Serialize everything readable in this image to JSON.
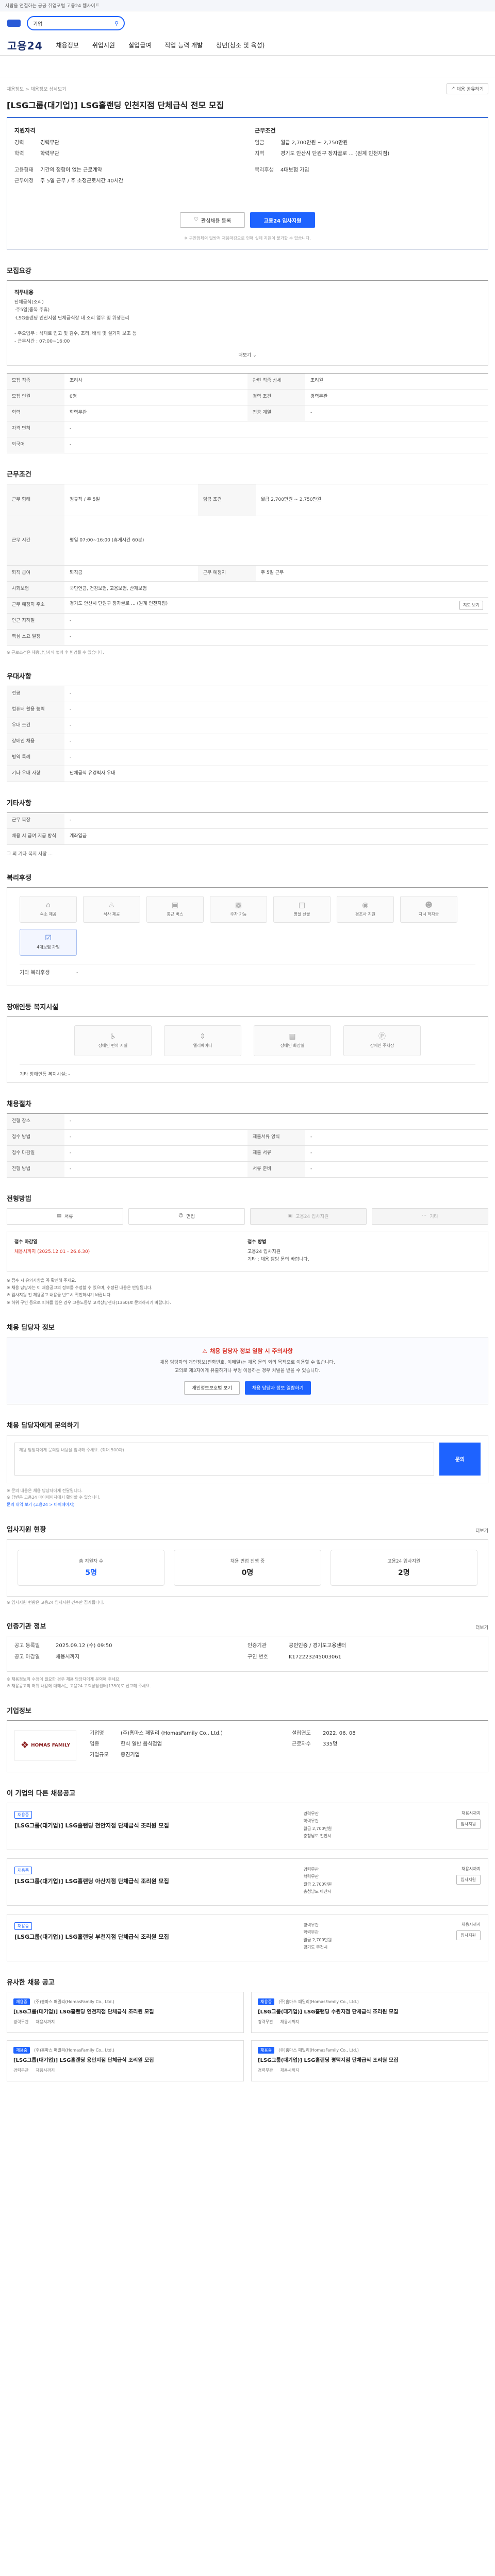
{
  "topbar": {
    "text": "사람을 연결하는 공공 취업포털 고용24 웹사이트"
  },
  "search": {
    "value": "기업"
  },
  "nav": {
    "brand": "고용24",
    "items": [
      "채용정보",
      "취업지원",
      "실업급여",
      "직업 능력 개발",
      "청년(청조 및 육성)"
    ]
  },
  "breadcrumb": "채용정보 > 채용정보 상세보기",
  "print_label": "채용 공유하기",
  "job_title": "[LSG그룹(대기업)] LSG홀랜딩 인천지점 단체급식 전모 모집",
  "summary": {
    "left_head": "지원자격",
    "left": [
      {
        "k": "경력",
        "v": "경력무관"
      },
      {
        "k": "학력",
        "v": "학력무관"
      },
      {
        "k": "",
        "v": ""
      },
      {
        "k": "고용형태",
        "v": "기간의 정함이 없는 근로계약"
      },
      {
        "k": "근무예정",
        "v": "주 5일 근무 / 주 소정근로시간 40시간"
      }
    ],
    "right_head": "근무조건",
    "right": [
      {
        "k": "임금",
        "v": "월급 2,700만원 ~ 2,750만원"
      },
      {
        "k": "지역",
        "v": "경기도 안산시 단원구 장자골로 ... (원계 인천지점)"
      },
      {
        "k": "",
        "v": ""
      },
      {
        "k": "복리후생",
        "v": "4대보험 가입"
      }
    ],
    "save_btn": "관심채용 등록",
    "apply_btn": "고용24 입사지원",
    "note": "※ 구인업체의 일방적 채용마감으로 인해 실제 지원이 불가할 수 있습니다."
  },
  "sections": {
    "recruit": "모집요강",
    "conditions": "근무조건",
    "preference": "우대사항",
    "etc": "기타사항",
    "benefits": "복리후생",
    "disabled": "장애인등 복지시설",
    "selection": "채용절차",
    "method": "전형방법",
    "warning": "채용 담당자 정보",
    "inquiry": "채용 담당자에게 문의하기",
    "stats": "입사지원 현황",
    "info": "인증기관 정보",
    "company": "기업정보",
    "related": "이 기업의 다른 채용공고",
    "similar": "유사한 채용 공고"
  },
  "recruit": {
    "desc_label": "직무내용",
    "desc": "단체급식(조리)\n·주5일(중복 주휴)\n·LSG홀랜딩 인천지점 단체급식장 내 조리 업무 및 위생관리\n\n- 주요업무 : 식재료 입고 및 검수, 조리, 배식 및 설거지 보조 등\n- 근무시간 : 07:00~16:00",
    "more": "더보기",
    "rows": [
      [
        {
          "k": "모집 직종",
          "v": "조리사"
        },
        {
          "k": "관련 직종 상세",
          "v": "조리원"
        }
      ],
      [
        {
          "k": "모집 인원",
          "v": "0명"
        },
        {
          "k": "경력 조건",
          "v": "경력무관"
        }
      ],
      [
        {
          "k": "학력",
          "v": "학력무관"
        },
        {
          "k": "전공 계열",
          "v": "-"
        }
      ],
      [
        {
          "k": "자격 면허",
          "v": "-"
        },
        {
          "k": "",
          "v": ""
        }
      ],
      [
        {
          "k": "외국어",
          "v": "-"
        },
        {
          "k": "",
          "v": ""
        }
      ]
    ]
  },
  "conditions": {
    "rows": [
      {
        "k": "근무 형태",
        "v": "정규직 / 주 5일",
        "k2": "임금 조건",
        "v2": "월급 2,700만원 ~ 2,750만원"
      },
      {
        "k": "근무 시간",
        "v": "평일 07:00~16:00 (휴게시간 60분)",
        "k2": "",
        "v2": ""
      },
      {
        "k": "퇴직 급여",
        "v": "퇴직금",
        "k2": "근무 예정지",
        "v2": "주 5일 근무"
      },
      {
        "k": "사회보험",
        "v": "국민연금, 건강보험, 고용보험, 산재보험",
        "k2": "",
        "v2": ""
      },
      {
        "k": "근무 예정지 주소",
        "v": "경기도 안산시 단원구 장자골로 ... (원계 인천지점)",
        "k2": "",
        "v2": ""
      },
      {
        "k": "인근 지하철",
        "v": "-",
        "k2": "",
        "v2": ""
      },
      {
        "k": "핵심 소요 일정",
        "v": "-",
        "k2": "",
        "v2": ""
      }
    ],
    "map_btn": "지도 보기",
    "note": "※ 근로조건은 채용담당자와 협의 후 변경될 수 있습니다."
  },
  "preference": {
    "rows": [
      {
        "k": "전공",
        "v": "-"
      },
      {
        "k": "컴퓨터 활용 능력",
        "v": "-"
      },
      {
        "k": "우대 조건",
        "v": "-"
      },
      {
        "k": "장애인 채용",
        "v": "-"
      },
      {
        "k": "병역 특례",
        "v": "-"
      },
      {
        "k": "기타 우대 사항",
        "v": "단체급식 유경력자 우대"
      }
    ]
  },
  "etc": {
    "rows": [
      {
        "k": "근무 복장",
        "v": "-"
      },
      {
        "k": "채용 시 급여 지급 방식",
        "v": "계좌입금"
      }
    ],
    "note": "그 외 기타 복지 사항 ..."
  },
  "benefits": {
    "items": [
      {
        "icon": "home-icon",
        "label": "숙소 제공"
      },
      {
        "icon": "meal-icon",
        "label": "식사 제공"
      },
      {
        "icon": "bus-icon",
        "label": "통근 버스"
      },
      {
        "icon": "car-icon",
        "label": "주차 가능"
      },
      {
        "icon": "gift-icon",
        "label": "명절 선물"
      },
      {
        "icon": "money-icon",
        "label": "경조사 지원"
      },
      {
        "icon": "child-icon",
        "label": "자녀 학자금"
      },
      {
        "icon": "insurance-icon",
        "label": "4대보험 가입"
      }
    ],
    "kv": [
      {
        "k": "기타 복리후생",
        "v": "-"
      },
      {
        "k": "",
        "v": ""
      }
    ]
  },
  "disabled": {
    "items": [
      {
        "icon": "ramp-icon",
        "label": "장애인 편의 시설"
      },
      {
        "icon": "elevator-icon",
        "label": "엘리베이터"
      },
      {
        "icon": "toilet-icon",
        "label": "장애인 화장실"
      },
      {
        "icon": "parking-icon",
        "label": "장애인 주차장"
      }
    ],
    "note": "기타 장애인등 복지시설: -"
  },
  "selection": {
    "rows": [
      [
        {
          "k": "전형 장소",
          "v": "-"
        },
        {
          "k": "",
          "v": ""
        }
      ],
      [
        {
          "k": "접수 방법",
          "v": "-"
        },
        {
          "k": "제출서류 양식",
          "v": "-"
        }
      ],
      [
        {
          "k": "접수 마감일",
          "v": "-"
        },
        {
          "k": "제출 서류",
          "v": "-"
        }
      ],
      [
        {
          "k": "전형 방법",
          "v": "-"
        },
        {
          "k": "서류 준비",
          "v": "-"
        }
      ]
    ]
  },
  "method": {
    "steps": [
      "서류",
      "면접",
      "고용24 입사지원",
      "기타"
    ],
    "left_hd": "접수 마감일",
    "left_red": "채용시까지 (2025.12.01 - 26.6.30)",
    "left_text": "",
    "right_hd": "접수 방법",
    "right_text": "고용24 입사지원\n기타 : 채용 담당 문의 바랍니다.",
    "bullets": [
      "※ 접수 시 유의사항을 꼭 확인해 주세요.",
      "※ 채용 담당자는 이 채용공고의 정보를 수정할 수 있으며, 수정된 내용은 반영됩니다.",
      "※ 입사지원 전 채용공고 내용을 반드시 확인하시기 바랍니다.",
      "※ 허위 구인 등으로 피해를 입은 경우 고용노동부 고객상담센터(1350)로 문의하시기 바랍니다."
    ]
  },
  "warning": {
    "title": "채용 담당자 정보 열람 시 주의사항",
    "text": "채용 담당자의 개인정보(전화번호, 이메일)는 채용 문의 외의 목적으로 이용할 수 없습니다.\n고의로 제3자에게 유출하거나 부정 이용하는 경우 처벌을 받을 수 있습니다.",
    "btn1": "개인정보보호법 보기",
    "btn2": "채용 담당자 정보 열람하기"
  },
  "inquiry": {
    "placeholder": "채용 담당자에게 문의할 내용을 입력해 주세요. (최대 500자)",
    "btn": "문의",
    "notes": [
      "※ 문의 내용은 채용 담당자에게 전달됩니다.",
      "※ 답변은 고용24 마이페이지에서 확인할 수 있습니다."
    ],
    "link_note": "문의 내역 보기 (고용24 > 마이페이지)"
  },
  "stats": {
    "link": "더보기",
    "items": [
      {
        "label": "총 지원자 수",
        "value": "5명"
      },
      {
        "label": "채용 면접 진행 중",
        "value": "0명"
      },
      {
        "label": "고용24 입사지원",
        "value": "2명"
      }
    ],
    "note": "※ 입사지원 현황은 고용24 입사지원 건수만 집계됩니다."
  },
  "info": {
    "link": "더보기",
    "left": [
      {
        "k": "공고 등록일",
        "v": "2025.09.12 (수) 09:50"
      },
      {
        "k": "공고 마감일",
        "v": "채용시까지"
      }
    ],
    "right": [
      {
        "k": "인증기관",
        "v": "공인인증 / 경기도고용센터"
      },
      {
        "k": "구인 번호",
        "v": "K172223245003061"
      }
    ],
    "notes": [
      "※ 채용정보의 수정이 필요한 경우 채용 담당자에게 문의해 주세요.",
      "※ 채용공고의 허위 내용에 대해서는 고용24 고객상담센터(1350)로 신고해 주세요."
    ]
  },
  "company": {
    "logo_text": "HOMAS FAMILY",
    "left": [
      {
        "k": "기업명",
        "v": "(주)홈마스 패밀리 (HomasFamily Co., Ltd.)"
      },
      {
        "k": "업종",
        "v": "한식 일반 음식점업"
      },
      {
        "k": "기업규모",
        "v": "중견기업"
      }
    ],
    "right": [
      {
        "k": "설립연도",
        "v": "2022. 06. 08"
      },
      {
        "k": "근로자수",
        "v": "335명"
      },
      {
        "k": "",
        "v": ""
      }
    ]
  },
  "related": [
    {
      "badge": "채용중",
      "title": "[LSG그룹(대기업)] LSG홀랜딩 천안지점 단체급식 조리원 모집",
      "info": [
        "경력무관",
        "학력무관",
        "월급 2,700만원",
        "충청남도 천안시"
      ],
      "deadline": "채용시까지",
      "apply": "입사지원"
    },
    {
      "badge": "채용중",
      "title": "[LSG그룹(대기업)] LSG홀랜딩 아산지점 단체급식 조리원 모집",
      "info": [
        "경력무관",
        "학력무관",
        "월급 2,700만원",
        "충청남도 아산시"
      ],
      "deadline": "채용시까지",
      "apply": "입사지원"
    },
    {
      "badge": "채용중",
      "title": "[LSG그룹(대기업)] LSG홀랜딩 부천지점 단체급식 조리원 모집",
      "info": [
        "경력무관",
        "학력무관",
        "월급 2,700만원",
        "경기도 부천시"
      ],
      "deadline": "채용시까지",
      "apply": "입사지원"
    }
  ],
  "similar": [
    {
      "badge": "채용중",
      "company": "(주)홈마스 패밀리(HomasFamily Co., Ltd.)",
      "title": "[LSG그룹(대기업)] LSG홀랜딩 인천지점 단체급식 조리원 모집",
      "meta": [
        "경력무관",
        "채용시까지"
      ]
    },
    {
      "badge": "채용중",
      "company": "(주)홈마스 패밀리(HomasFamily Co., Ltd.)",
      "title": "[LSG그룹(대기업)] LSG홀랜딩 수원지점 단체급식 조리원 모집",
      "meta": [
        "경력무관",
        "채용시까지"
      ]
    },
    {
      "badge": "채용중",
      "company": "(주)홈마스 패밀리(HomasFamily Co., Ltd.)",
      "title": "[LSG그룹(대기업)] LSG홀랜딩 용인지점 단체급식 조리원 모집",
      "meta": [
        "경력무관",
        "채용시까지"
      ]
    },
    {
      "badge": "채용중",
      "company": "(주)홈마스 패밀리(HomasFamily Co., Ltd.)",
      "title": "[LSG그룹(대기업)] LSG홀랜딩 평택지점 단체급식 조리원 모집",
      "meta": [
        "경력무관",
        "채용시까지"
      ]
    }
  ]
}
